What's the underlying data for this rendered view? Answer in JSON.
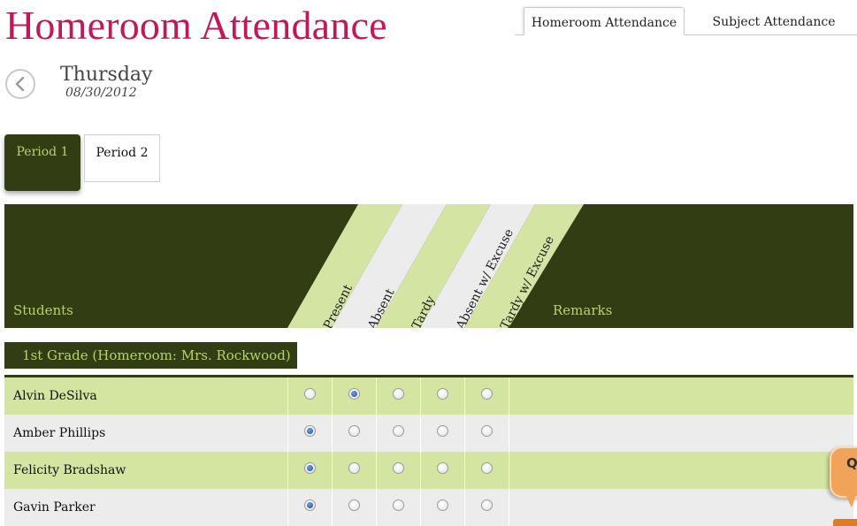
{
  "header": {
    "title": "Homeroom Attendance"
  },
  "tabs": [
    {
      "label": "Homeroom Attendance",
      "active": true
    },
    {
      "label": "Subject Attendance",
      "active": false
    }
  ],
  "date": {
    "day": "Thursday",
    "date": "08/30/2012"
  },
  "periods": [
    {
      "label": "Period 1",
      "active": true
    },
    {
      "label": "Period 2",
      "active": false
    }
  ],
  "table": {
    "students_label": "Students",
    "remarks_label": "Remarks",
    "columns": [
      "Present",
      "Absent",
      "Tardy",
      "Absent w/ Excuse",
      "Tardy w/ Excuse"
    ]
  },
  "group": {
    "label": "1st Grade (Homeroom: Mrs. Rockwood)"
  },
  "students": [
    {
      "name": "Alvin DeSilva",
      "selected": "Absent"
    },
    {
      "name": "Amber Phillips",
      "selected": "Present"
    },
    {
      "name": "Felicity Bradshaw",
      "selected": "Present"
    },
    {
      "name": "Gavin Parker",
      "selected": "Present"
    }
  ],
  "help": {
    "label": "Q"
  },
  "colors": {
    "title": "#c0185a",
    "dark_olive": "#323d14",
    "light_green": "#d3e5a1",
    "stripe_light": "#d4e5a3",
    "stripe_gray": "#ececec",
    "help_orange": "#f2a35a"
  },
  "icons": {
    "back": "chevron-left-icon"
  }
}
